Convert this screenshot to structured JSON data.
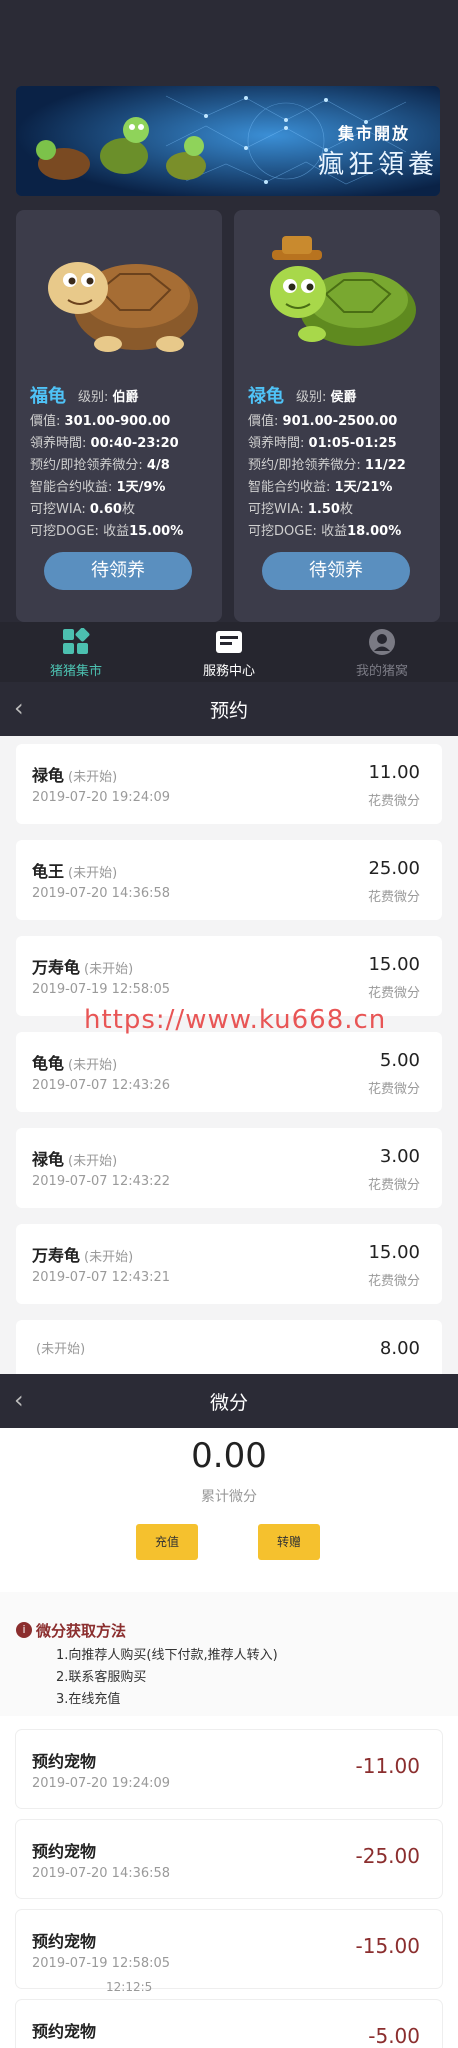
{
  "colors": {
    "accent_blue": "#4fc3f7",
    "button_blue": "#5a8fbf",
    "dark_bg": "#2b2b36",
    "gold": "#f5c12e",
    "minus_red": "#8b2e2e",
    "watermark": "#e85555"
  },
  "banner": {
    "title": "集市開放",
    "subtitle": "瘋狂領養"
  },
  "cards": [
    {
      "name": "福龟",
      "level_label": "级别:",
      "level": "伯爵",
      "price_label": "價值:",
      "price": "301.00-900.00",
      "time_label": "領养時間:",
      "time": "00:40-23:20",
      "reserve_label": "预约/即抢领养微分:",
      "reserve": "4/8",
      "yield_label": "智能合约收益:",
      "yield": "1天/9%",
      "wia_label": "可挖WIA:",
      "wia": "0.60",
      "wia_unit": "枚",
      "doge_label": "可挖DOGE:",
      "doge_yield_label": "收益",
      "doge": "15.00%",
      "button": "待领养"
    },
    {
      "name": "禄龟",
      "level_label": "级别:",
      "level": "侯爵",
      "price_label": "價值:",
      "price": "901.00-2500.00",
      "time_label": "領养時間:",
      "time": "01:05-01:25",
      "reserve_label": "预约/即抢领养微分:",
      "reserve": "11/22",
      "yield_label": "智能合约收益:",
      "yield": "1天/21%",
      "wia_label": "可挖WIA:",
      "wia": "1.50",
      "wia_unit": "枚",
      "doge_label": "可挖DOGE:",
      "doge_yield_label": "收益",
      "doge": "18.00%",
      "button": "待领养"
    }
  ],
  "tabbar": [
    {
      "label": "猪猪集市",
      "icon": "grid-icon",
      "active": true
    },
    {
      "label": "服務中心",
      "icon": "service-icon",
      "active": false
    },
    {
      "label": "我的猪窝",
      "icon": "user-icon",
      "active": false
    }
  ],
  "reservations": {
    "title": "预约",
    "back_icon": "chevron-left-icon",
    "cost_caption": "花费微分",
    "items": [
      {
        "name": "禄龟",
        "status": "(未开始)",
        "date": "2019-07-20 19:24:09",
        "amount": "11.00"
      },
      {
        "name": "龟王",
        "status": "(未开始)",
        "date": "2019-07-20 14:36:58",
        "amount": "25.00"
      },
      {
        "name": "万寿龟",
        "status": "(未开始)",
        "date": "2019-07-19 12:58:05",
        "amount": "15.00"
      },
      {
        "name": "龟龟",
        "status": "(未开始)",
        "date": "2019-07-07 12:43:26",
        "amount": "5.00"
      },
      {
        "name": "禄龟",
        "status": "(未开始)",
        "date": "2019-07-07 12:43:22",
        "amount": "3.00"
      },
      {
        "name": "万寿龟",
        "status": "(未开始)",
        "date": "2019-07-07 12:43:21",
        "amount": "15.00"
      },
      {
        "name": "",
        "status": "(未开始)",
        "date": "",
        "amount": "8.00"
      }
    ]
  },
  "watermark": "https://www.ku668.cn",
  "points": {
    "title": "微分",
    "back_icon": "chevron-left-icon",
    "total": "0.00",
    "total_caption": "累计微分",
    "recharge_button": "充值",
    "transfer_button": "转赠",
    "howto_title": "微分获取方法",
    "howto_lines": [
      "1.向推荐人购买(线下付款,推荐人转入)",
      "2.联系客服购买",
      "3.在线充值"
    ],
    "items": [
      {
        "name": "预约宠物",
        "date": "2019-07-20 19:24:09",
        "amount": "-11.00"
      },
      {
        "name": "预约宠物",
        "date": "2019-07-20 14:36:58",
        "amount": "-25.00"
      },
      {
        "name": "预约宠物",
        "date": "2019-07-19 12:58:05",
        "amount": "-15.00"
      },
      {
        "name": "预约宠物",
        "date": "",
        "amount": "-5.00"
      }
    ],
    "stray_text": "12:12:5"
  }
}
